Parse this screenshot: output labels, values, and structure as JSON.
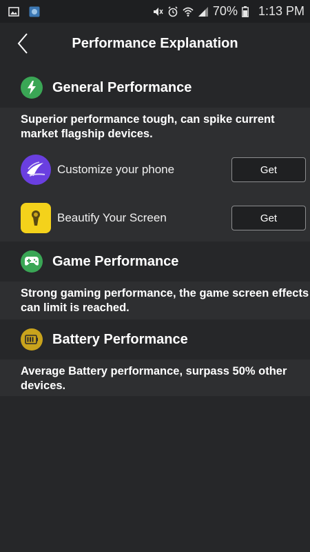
{
  "status_bar": {
    "battery": "70%",
    "time": "1:13 PM"
  },
  "header": {
    "title": "Performance Explanation"
  },
  "sections": {
    "general": {
      "title": "General Performance",
      "icon": "lightning-icon",
      "icon_color": "#3aa655",
      "description_line1": "Superior performance tough, can spike current",
      "description_line2": "market flagship devices.",
      "apps": [
        {
          "name": "Customize your phone",
          "button": "Get",
          "icon": "apus-launcher-icon",
          "icon_color": "#6a3fe0"
        },
        {
          "name": "Beautify Your Screen",
          "button": "Get",
          "icon": "keyhole-lock-icon",
          "icon_color": "#f4d21b"
        }
      ]
    },
    "game": {
      "title": "Game Performance",
      "icon": "gamepad-icon",
      "icon_color": "#3aa655",
      "description_line1": "Strong gaming performance, the game screen effects",
      "description_line2": "can limit is reached."
    },
    "battery": {
      "title": "Battery Performance",
      "icon": "battery-icon",
      "icon_color": "#c9a31c",
      "description_line1": "Average Battery performance, surpass 50% other",
      "description_line2": "devices."
    }
  }
}
